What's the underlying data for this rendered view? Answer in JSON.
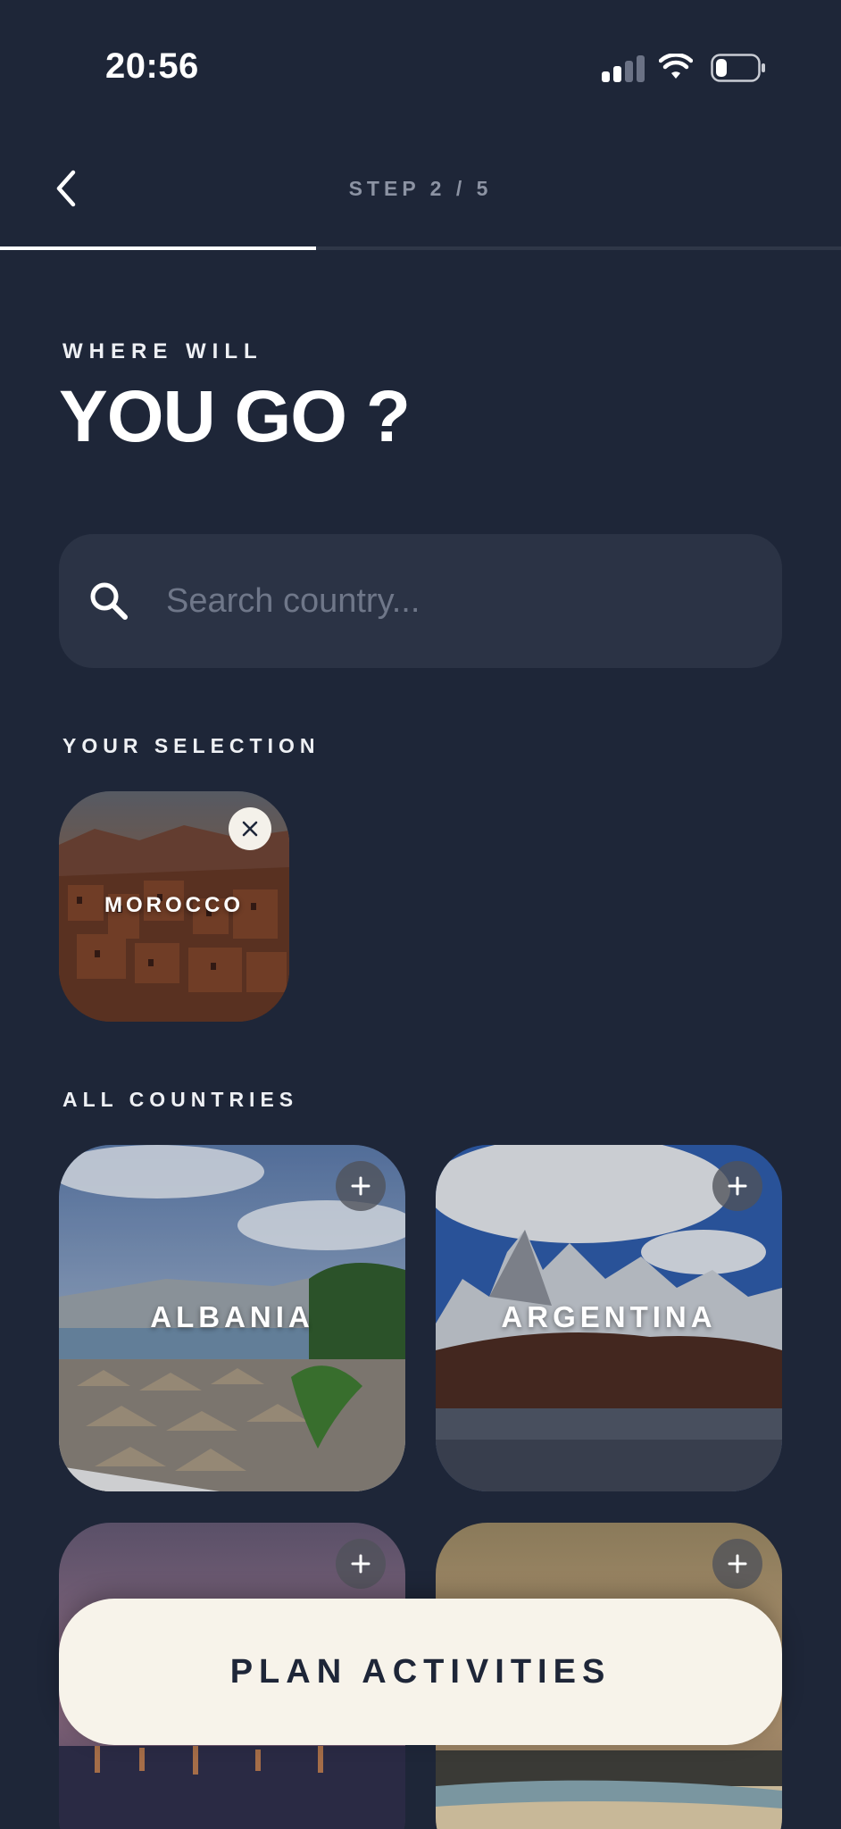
{
  "status_bar": {
    "time": "20:56",
    "icons": [
      "cellular-signal-icon",
      "wifi-icon",
      "battery-icon"
    ],
    "battery_level": 0.25
  },
  "nav": {
    "back_icon": "chevron-left-icon",
    "step_label": "STEP 2 / 5",
    "progress": 0.4
  },
  "hero": {
    "eyebrow": "WHERE WILL",
    "headline": "YOU GO ?"
  },
  "search": {
    "icon": "search-icon",
    "value": "",
    "placeholder": "Search country..."
  },
  "selection": {
    "label": "YOUR SELECTION",
    "items": [
      {
        "name": "MOROCCO",
        "remove_icon": "close-icon"
      }
    ]
  },
  "countries": {
    "label": "ALL COUNTRIES",
    "items": [
      {
        "name": "ALBANIA",
        "add_icon": "plus-icon"
      },
      {
        "name": "ARGENTINA",
        "add_icon": "plus-icon"
      },
      {
        "name": "",
        "add_icon": "plus-icon"
      },
      {
        "name": "",
        "add_icon": "plus-icon"
      }
    ]
  },
  "cta": {
    "label": "PLAN ACTIVITIES"
  },
  "colors": {
    "background": "#1e2638",
    "surface": "#2b3345",
    "cta_background": "#f7f3ea",
    "cta_text": "#1e2638",
    "muted_text": "#8c93a3"
  }
}
